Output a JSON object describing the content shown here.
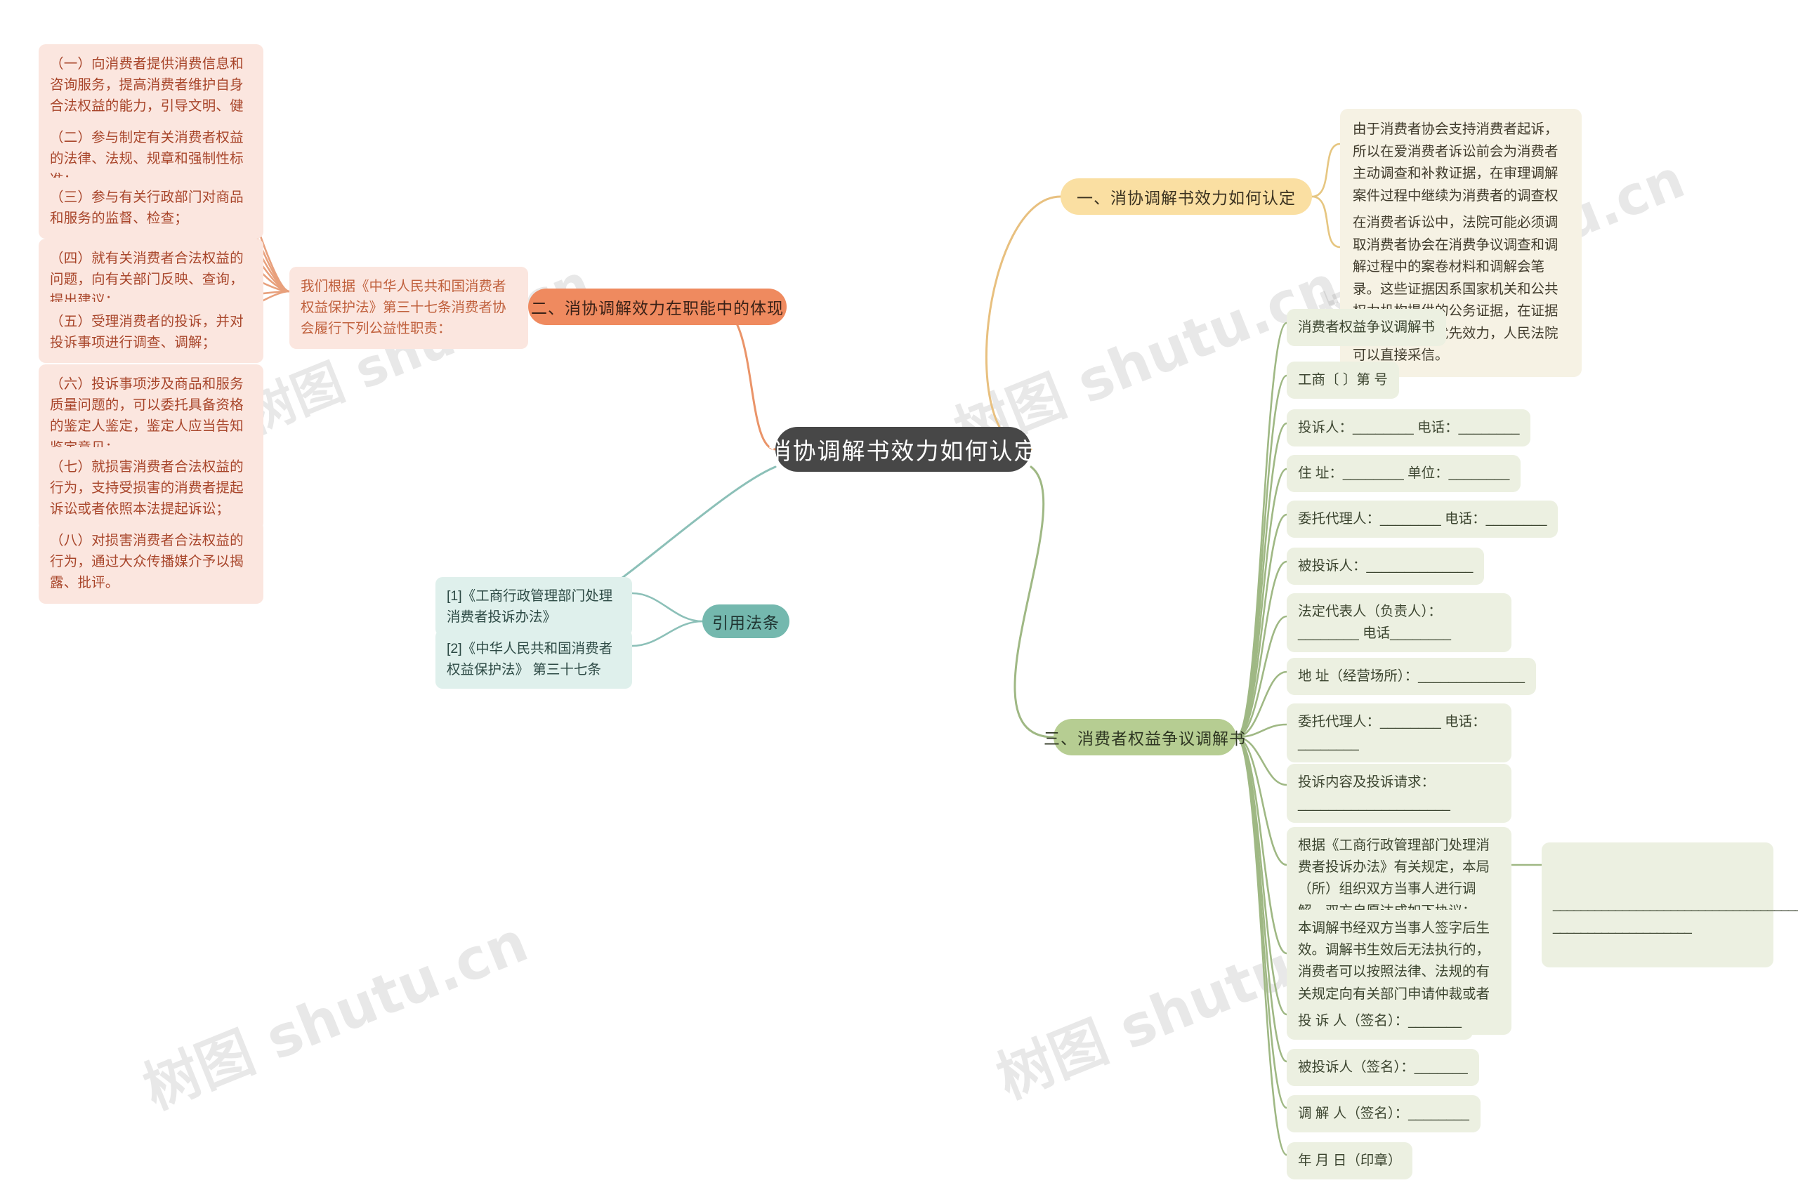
{
  "root": {
    "label": "消协调解书效力如何认定"
  },
  "watermark": {
    "text_a": "树图 shutu.cn",
    "text_b": "树图 shutu.cn",
    "text_c": "树图 shutu.cn",
    "text_d": "树图 shutu.cn",
    "text_e": "树图 shutu.cn"
  },
  "colors": {
    "root_bg": "#474747",
    "salmon_pill": "#ef8a5f",
    "yellow_pill": "#fadfa2",
    "green_pill": "#b6cd92",
    "teal_pill": "#74b8ae",
    "salmon_leaf": "#fbe6df",
    "cream_leaf": "#f6f2e4",
    "green_leaf": "#ecf0e1",
    "teal_leaf": "#dff0ec",
    "link_salmon": "#e8a07c",
    "link_yellow": "#e6c681",
    "link_green": "#9fb884",
    "link_teal": "#8cc0b8"
  },
  "branches": {
    "one": {
      "label": "一、消协调解书效力如何认定"
    },
    "two": {
      "label": "二、消协调解效力在职能中的体现"
    },
    "three": {
      "label": "三、消费者权益争议调解书"
    },
    "refs": {
      "label": "引用法条"
    }
  },
  "branch_one_items": [
    {
      "text": "由于消费者协会支持消费者起诉，所以在爱消费者诉讼前会为消费者主动调查和补救证据，在审理调解案件过程中继续为消费者的调查权而形成的案卷证据材料。"
    },
    {
      "text": "在消费者诉讼中，法院可能必须调取消费者协会在消费争议调查和调解过程中的案卷材料和调解会笔录。这些证据因系国家机关和公共权力机构提供的公务证据，在证据证明力上具有优先效力，人民法院可以直接采信。"
    }
  ],
  "branch_two_intro": {
    "text": "我们根据《中华人民共和国消费者权益保护法》第三十七条消费者协会履行下列公益性职责："
  },
  "branch_two_items": [
    {
      "text": "（一）向消费者提供消费信息和咨询服务，提高消费者维护自身合法权益的能力，引导文明、健康、节约资源和保护环境的消费方式；"
    },
    {
      "text": "（二）参与制定有关消费者权益的法律、法规、规章和强制性标准；"
    },
    {
      "text": "（三）参与有关行政部门对商品和服务的监督、检查；"
    },
    {
      "text": "（四）就有关消费者合法权益的问题，向有关部门反映、查询，提出建议；"
    },
    {
      "text": "（五）受理消费者的投诉，并对投诉事项进行调查、调解；"
    },
    {
      "text": "（六）投诉事项涉及商品和服务质量问题的，可以委托具备资格的鉴定人鉴定，鉴定人应当告知鉴定意见；"
    },
    {
      "text": "（七）就损害消费者合法权益的行为，支持受损害的消费者提起诉讼或者依照本法提起诉讼；"
    },
    {
      "text": "（八）对损害消费者合法权益的行为，通过大众传播媒介予以揭露、批评。"
    }
  ],
  "branch_three_items": [
    {
      "text": "消费者权益争议调解书"
    },
    {
      "text": "工商〔    〕第  号"
    },
    {
      "text": "投诉人：________  电话：________"
    },
    {
      "text": "住  址：________  单位：________"
    },
    {
      "text": "委托代理人：________      电话：________"
    },
    {
      "text": "被投诉人：______________"
    },
    {
      "text": "法定代表人（负责人）：________        电话________"
    },
    {
      "text": "地 址（经营场所）：______________"
    },
    {
      "text": "委托代理人：________      电话：________"
    },
    {
      "text": "投诉内容及投诉请求：____________________"
    },
    {
      "text": "根据《工商行政管理部门处理消费者投诉办法》有关规定，本局（所）组织双方当事人进行调解，双方自愿达成如下协议："
    },
    {
      "text": "本调解书经双方当事人签字后生效。调解书生效后无法执行的，消费者可以按照法律、法规的有关规定向有关部门申请仲裁或者向人民法院提起诉讼。"
    },
    {
      "text": "投 诉 人（签名）：_______"
    },
    {
      "text": "被投诉人（签名）：_______"
    },
    {
      "text": "调 解 人（签名）：________"
    },
    {
      "text": "年  月  日（印章）"
    }
  ],
  "branch_three_blank": {
    "text": "_______________________________________\n____________________"
  },
  "refs_items": [
    {
      "text": "[1]《工商行政管理部门处理消费者投诉办法》"
    },
    {
      "text": "[2]《中华人民共和国消费者权益保护法》 第三十七条"
    }
  ]
}
